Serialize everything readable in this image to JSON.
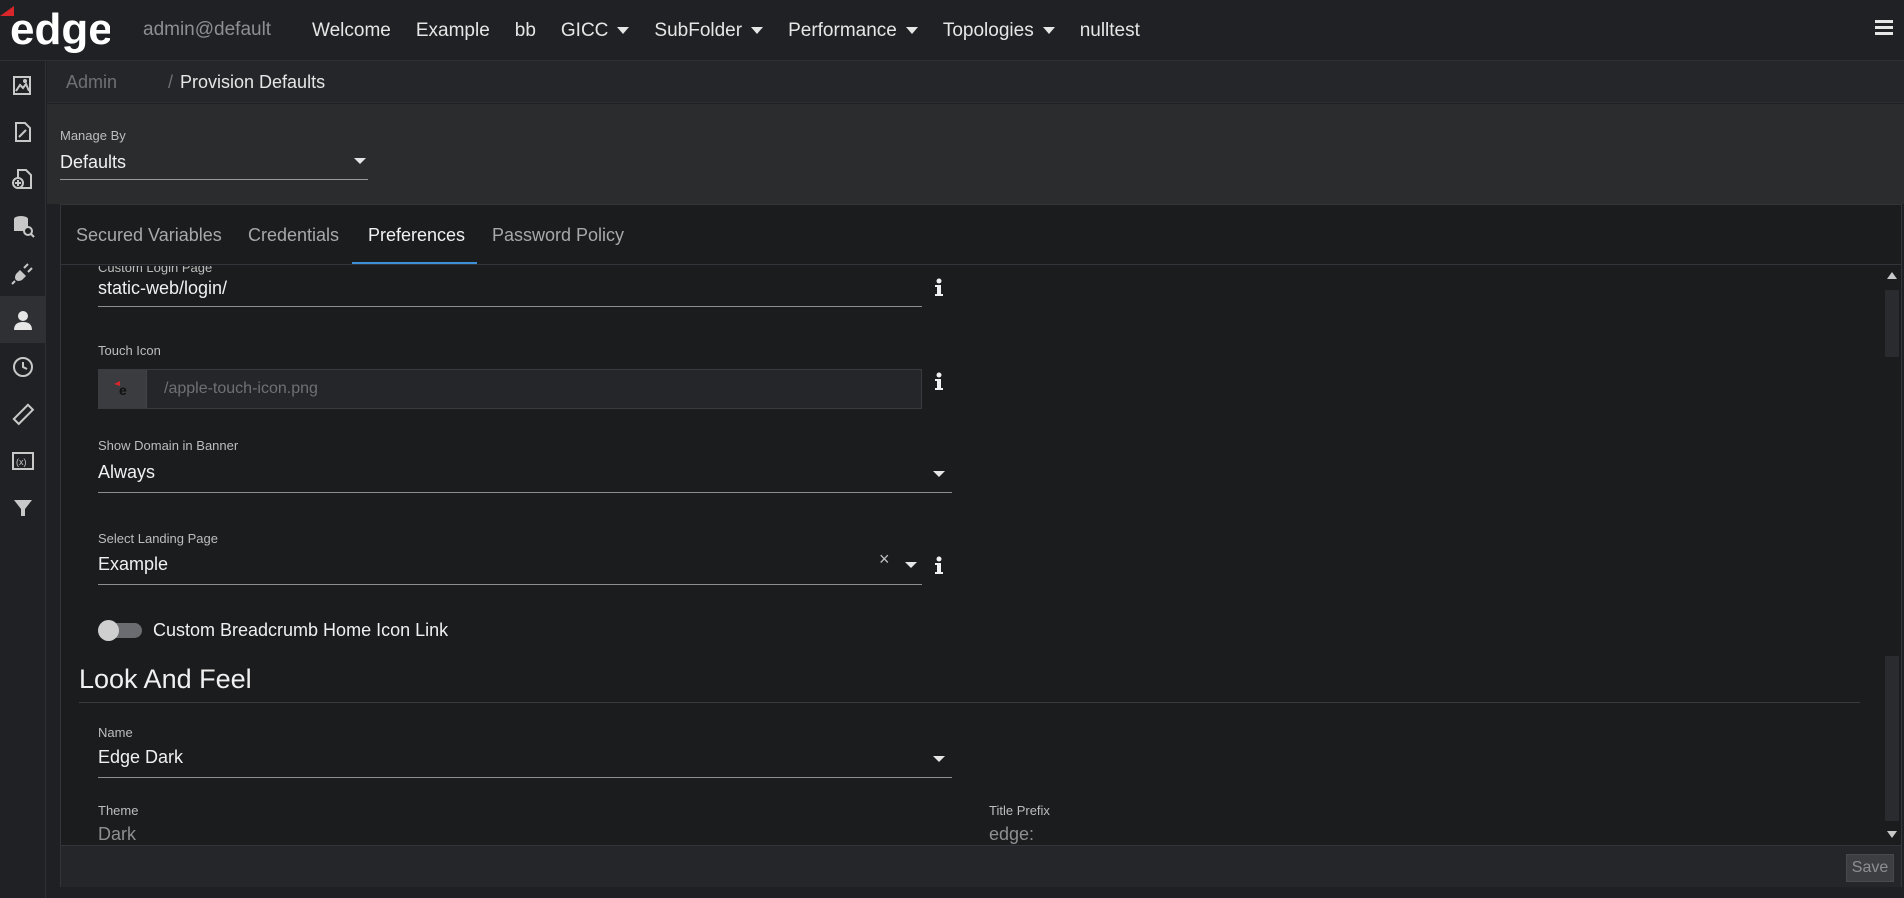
{
  "header": {
    "logo_text": "edge",
    "user": "admin@default",
    "nav": [
      {
        "label": "Welcome",
        "dropdown": false
      },
      {
        "label": "Example",
        "dropdown": false
      },
      {
        "label": "bb",
        "dropdown": false
      },
      {
        "label": "GICC",
        "dropdown": true
      },
      {
        "label": "SubFolder",
        "dropdown": true
      },
      {
        "label": "Performance",
        "dropdown": true
      },
      {
        "label": "Topologies",
        "dropdown": true
      },
      {
        "label": "nulltest",
        "dropdown": false
      }
    ],
    "menu_icon": "hamburger-menu-icon"
  },
  "sidebar": {
    "items": [
      {
        "icon": "image-document-icon"
      },
      {
        "icon": "edit-document-icon"
      },
      {
        "icon": "add-document-icon"
      },
      {
        "icon": "database-search-icon"
      },
      {
        "icon": "plug-icon"
      },
      {
        "icon": "user-icon",
        "active": true
      },
      {
        "icon": "history-icon"
      },
      {
        "icon": "ruler-icon"
      },
      {
        "icon": "variable-icon"
      },
      {
        "icon": "filter-icon"
      }
    ]
  },
  "breadcrumb": {
    "parent": "Admin",
    "separator": "/",
    "current": "Provision Defaults"
  },
  "manage_by": {
    "label": "Manage By",
    "value": "Defaults"
  },
  "tabs": [
    {
      "label": "Secured Variables"
    },
    {
      "label": "Credentials"
    },
    {
      "label": "Preferences",
      "active": true
    },
    {
      "label": "Password Policy"
    }
  ],
  "form": {
    "custom_login_page": {
      "label": "Custom Login Page",
      "value": "static-web/login/"
    },
    "touch_icon": {
      "label": "Touch Icon",
      "placeholder": "/apple-touch-icon.png"
    },
    "show_domain": {
      "label": "Show Domain in Banner",
      "value": "Always"
    },
    "landing_page": {
      "label": "Select Landing Page",
      "value": "Example",
      "clear": "×"
    },
    "breadcrumb_toggle": {
      "label": "Custom Breadcrumb Home Icon Link",
      "on": false
    },
    "look_and_feel": {
      "title": "Look And Feel",
      "name": {
        "label": "Name",
        "value": "Edge Dark"
      },
      "theme": {
        "label": "Theme",
        "value": "Dark"
      },
      "title_prefix": {
        "label": "Title Prefix",
        "value": "edge:"
      }
    }
  },
  "footer": {
    "save_label": "Save"
  },
  "colors": {
    "accent": "#3d8fd8",
    "logo_red": "#d9262b",
    "background": "#1f2023"
  }
}
